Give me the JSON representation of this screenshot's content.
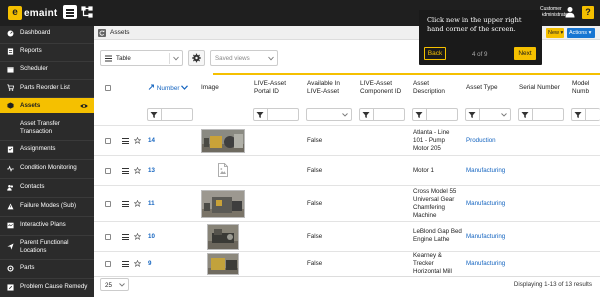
{
  "app": {
    "logo_text": "emaint",
    "logo_mark": "e"
  },
  "topbar": {
    "user_label": "Customer Administrator",
    "help_label": "?"
  },
  "sidebar": {
    "items": [
      {
        "label": "Dashboard",
        "icon": "dashboard-icon"
      },
      {
        "label": "Reports",
        "icon": "reports-icon"
      },
      {
        "label": "Scheduler",
        "icon": "calendar-icon"
      },
      {
        "label": "Parts Reorder List",
        "icon": "cart-icon"
      },
      {
        "label": "Assets",
        "icon": "asset-icon",
        "active": true
      },
      {
        "label": "Asset Transfer Transaction",
        "icon": "transfer-icon"
      },
      {
        "label": "Assignments",
        "icon": "assignments-icon"
      },
      {
        "label": "Condition Monitoring",
        "icon": "monitoring-icon"
      },
      {
        "label": "Contacts",
        "icon": "contacts-icon"
      },
      {
        "label": "Failure Modes (Sub)",
        "icon": "failure-icon"
      },
      {
        "label": "Interactive Plans",
        "icon": "plans-icon"
      },
      {
        "label": "Parent Functional Locations",
        "icon": "location-icon"
      },
      {
        "label": "Parts",
        "icon": "parts-icon"
      },
      {
        "label": "Problem Cause Remedy",
        "icon": "problem-icon"
      }
    ]
  },
  "page": {
    "title": "Assets",
    "new_label": "New ▾",
    "actions_label": "Actions ▾"
  },
  "toolbar": {
    "view_label": "Table",
    "saved_views_placeholder": "Saved views"
  },
  "table": {
    "headers": {
      "number": "Number",
      "image": "Image",
      "live_portal": "LIVE-Asset Portal ID",
      "available": "Available In LIVE-Asset",
      "live_component": "LIVE-Asset Component ID",
      "description": "Asset Description",
      "type": "Asset Type",
      "serial": "Serial Number",
      "model": "Model Numb"
    },
    "rows": [
      {
        "number": "14",
        "available": "False",
        "description": "Atlanta - Line 101 - Pump Motor 205",
        "type": "Production",
        "image": "photo"
      },
      {
        "number": "13",
        "available": "False",
        "description": "Motor 1",
        "type": "Manufacturing",
        "image": "placeholder"
      },
      {
        "number": "11",
        "available": "False",
        "description": "Cross Model 55 Universal Gear Chamfering Machine",
        "type": "Manufacturing",
        "image": "photo"
      },
      {
        "number": "10",
        "available": "False",
        "description": "LeBlond Gap Bed Engine Lathe",
        "type": "Manufacturing",
        "image": "photo"
      },
      {
        "number": "9",
        "available": "False",
        "description": "Kearney & Trecker Horizontal Mill",
        "type": "Manufacturing",
        "image": "photo"
      }
    ]
  },
  "footer": {
    "page_size": "25",
    "displaying": "Displaying 1-13 of 13 results"
  },
  "tour": {
    "text": "Click new in the upper right hand corner of the screen.",
    "back_label": "Back",
    "step_label": "4 of 9",
    "next_label": "Next"
  },
  "colors": {
    "accent": "#f5c000",
    "link": "#1565c0",
    "sidebar_bg": "#2b2b2b",
    "topbar_bg": "#1f1f1f",
    "actions_blue": "#1976d2"
  }
}
